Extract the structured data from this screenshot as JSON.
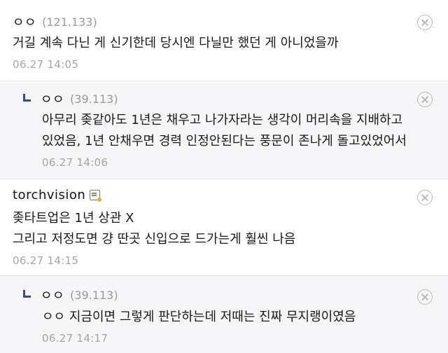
{
  "comments": [
    {
      "nick": "ㅇㅇ",
      "ip": "(121.133)",
      "lines": [
        "거길 계속 다닌 게 신기한데 당시엔 다닐만 했던 게 아니었을까"
      ],
      "time": "06.27 14:05"
    },
    {
      "nick": "ㅇㅇ",
      "ip": "(39.113)",
      "lines": [
        "아무리 좆같아도 1년은 채우고 나가자라는 생각이 머리속을 지배하고",
        "있었음, 1년 안채우면 경력 인정안된다는 풍문이 존나게 돌고있었어서"
      ],
      "time": "06.27 14:06"
    },
    {
      "nick": "torchvision",
      "badge_icon": "gallery-member-icon",
      "lines": [
        "좆타트업은 1년 상관 X",
        "그리고 저정도면 걍 딴곳 신입으로 드가는게 훨씬 나음"
      ],
      "time": "06.27 14:15"
    },
    {
      "nick": "ㅇㅇ",
      "ip": "(39.113)",
      "lines": [
        "ㅇㅇ 지금이면 그렇게 판단하는데 저때는 진짜 무지랭이였음"
      ],
      "time": "06.27 14:17"
    }
  ],
  "colors": {
    "reply_bg": "#f6f6f8",
    "reply_arrow": "#3b4a8c",
    "meta_gray": "#9a9a9a"
  },
  "icons": {
    "delete": "close-circle-icon",
    "reply": "reply-arrow-icon"
  }
}
